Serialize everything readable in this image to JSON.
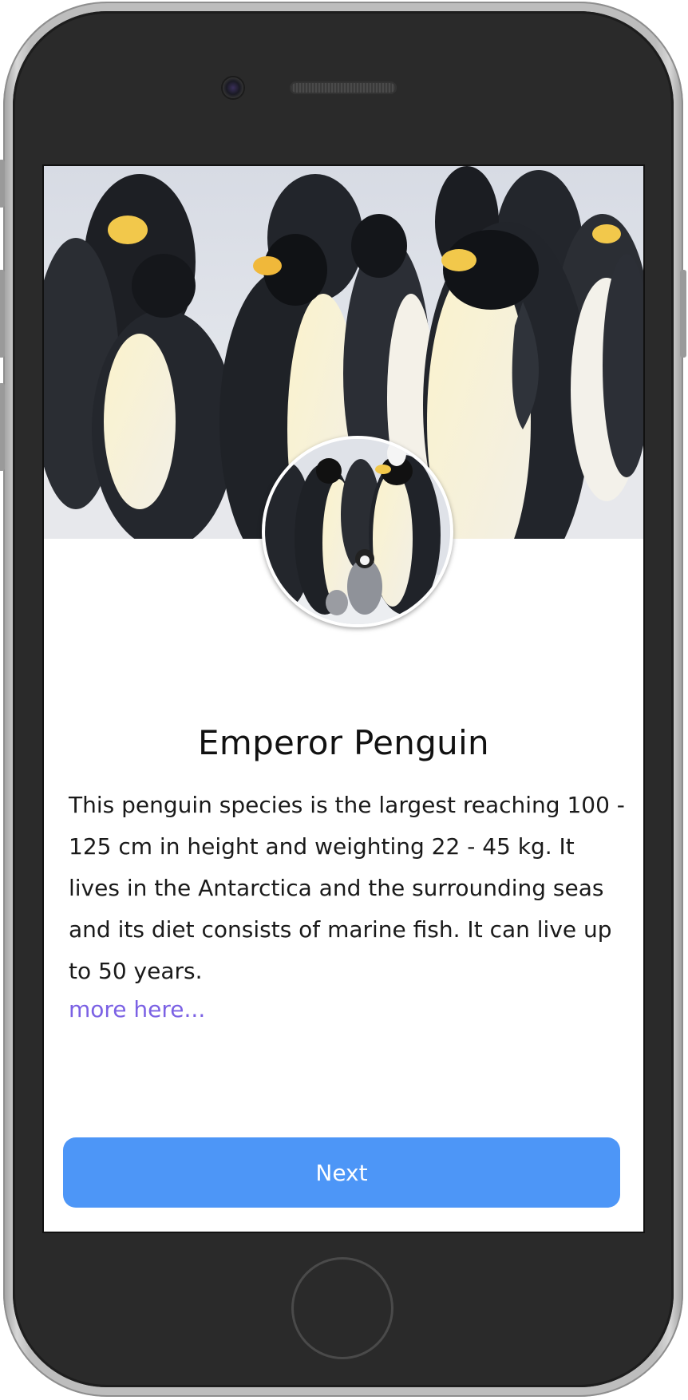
{
  "app": {
    "title": "Emperor Penguin",
    "description": "This penguin species is the largest reaching 100 - 125 cm in height and weighting 22 - 45 kg. It lives in the Antarctica and the surrounding seas and its diet consists of marine fish. It can live up to 50 years.",
    "more_link": "more here...",
    "next_button": "Next"
  },
  "images": {
    "hero": "emperor-penguin-colony-photo",
    "avatar": "emperor-penguins-with-chick-photo"
  },
  "colors": {
    "accent_button": "#4d96f7",
    "link": "#7b61e4",
    "device_body": "#2a2a2a"
  }
}
